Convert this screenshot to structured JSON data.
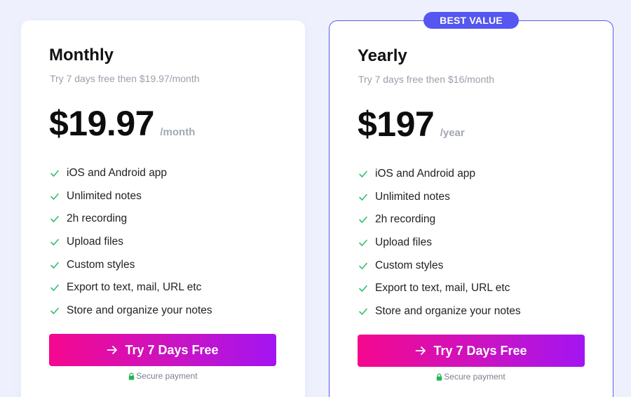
{
  "badge": "BEST VALUE",
  "plans": [
    {
      "name": "Monthly",
      "subtitle": "Try 7 days free then $19.97/month",
      "price": "$19.97",
      "period": "/month",
      "features": [
        "iOS and Android app",
        "Unlimited notes",
        "2h recording",
        "Upload files",
        "Custom styles",
        "Export to text, mail, URL etc",
        "Store and organize your notes"
      ],
      "cta": "Try 7 Days Free",
      "secure": "Secure payment"
    },
    {
      "name": "Yearly",
      "subtitle": "Try 7 days free then $16/month",
      "price": "$197",
      "period": "/year",
      "features": [
        "iOS and Android app",
        "Unlimited notes",
        "2h recording",
        "Upload files",
        "Custom styles",
        "Export to text, mail, URL etc",
        "Store and organize your notes"
      ],
      "cta": "Try 7 Days Free",
      "secure": "Secure payment"
    }
  ],
  "icons": {
    "feature": "check-icon",
    "cta": "arrow-right-icon",
    "secure": "lock-icon"
  },
  "colors": {
    "background": "#eef1fd",
    "accent": "#5656f0",
    "check": "#2fbf71",
    "cta_start": "#f5088e",
    "cta_end": "#a314f2",
    "secure_lock": "#22b455"
  }
}
